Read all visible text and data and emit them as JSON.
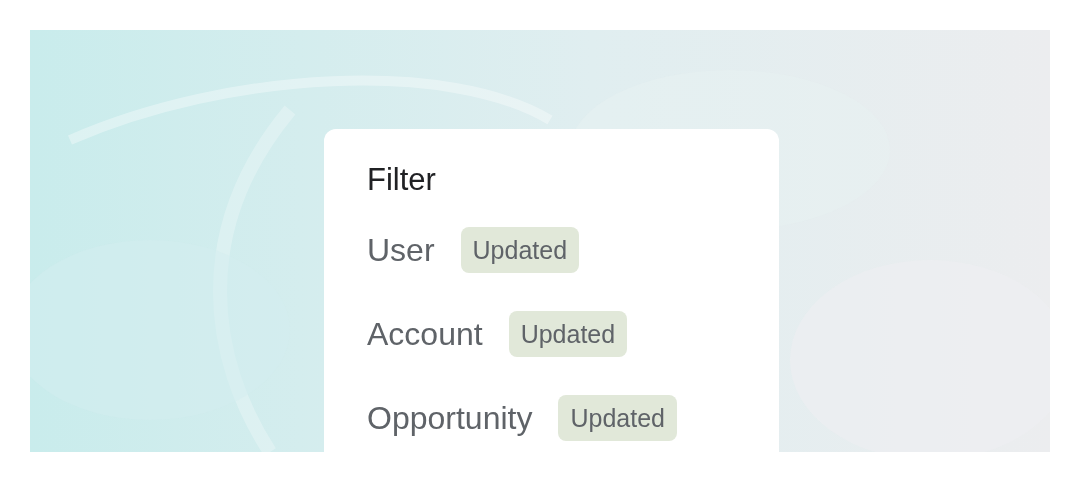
{
  "filter": {
    "title": "Filter",
    "items": [
      {
        "label": "User",
        "badge": "Updated"
      },
      {
        "label": "Account",
        "badge": "Updated"
      },
      {
        "label": "Opportunity",
        "badge": "Updated"
      }
    ]
  }
}
